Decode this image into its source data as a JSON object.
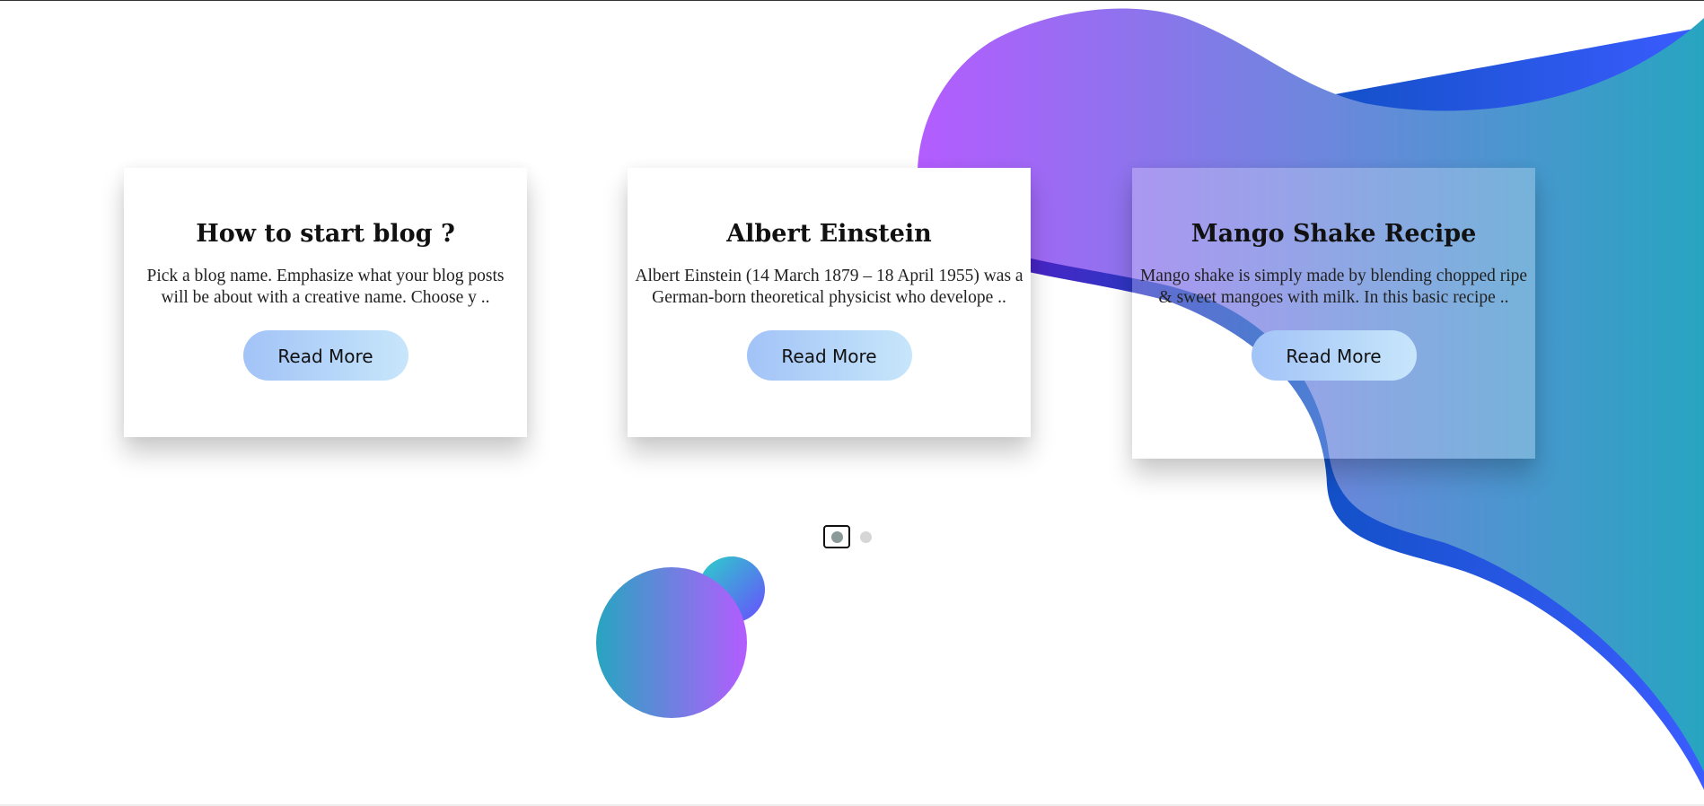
{
  "colors": {
    "blob_start": "#b45cff",
    "blob_mid": "#6f86de",
    "blob_end": "#27a5c0",
    "blob_edge_dark": "#5a1dc4",
    "blob_edge_blue": "#1e5cdb",
    "button_start": "#a2c3f7",
    "button_end": "#c7e6fb"
  },
  "cards": [
    {
      "title": "How to start blog ?",
      "excerpt": "Pick a blog name. Emphasize what your blog posts will be about with a creative name. Choose y ..",
      "button_label": "Read More"
    },
    {
      "title": "Albert Einstein",
      "excerpt": "Albert Einstein (14 March 1879 – 18 April 1955) was a German-born theoretical physicist who develope ..",
      "button_label": "Read More"
    },
    {
      "title": "Mango Shake Recipe",
      "excerpt": "Mango shake is simply made by blending chopped ripe & sweet mangoes with milk. In this basic recipe ..",
      "button_label": "Read More"
    }
  ],
  "pagination": {
    "page_count": 2,
    "active_index": 0
  }
}
